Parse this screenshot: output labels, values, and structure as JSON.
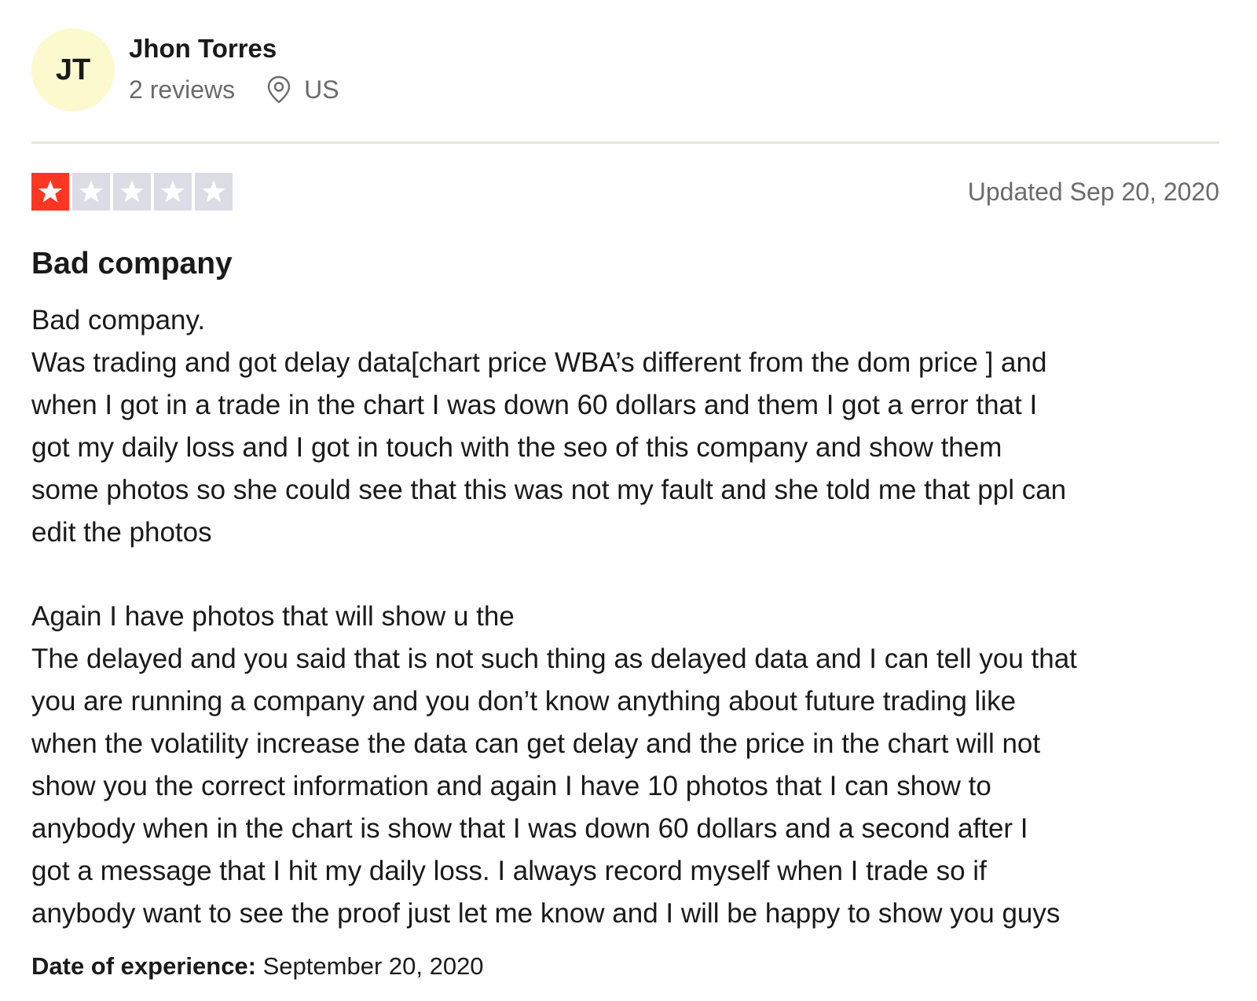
{
  "consumer": {
    "initials": "JT",
    "name": "Jhon Torres",
    "reviews_count": "2 reviews",
    "location": "US",
    "avatar_color": "#fdf9cf"
  },
  "rating": {
    "stars_filled": 1,
    "stars_total": 5,
    "filled_color": "#ff3722",
    "empty_color": "#dcdce6"
  },
  "review": {
    "date_label": "Updated Sep 20, 2020",
    "title": "Bad company",
    "body_lines": [
      "Bad company.",
      "Was trading and got delay data[chart price WBA’s different from the dom price ] and",
      "when I got in a trade in the chart I was down 60 dollars and them I got a error that I",
      "got my daily loss and I got in touch with the seo of this company and show them",
      "some photos so she could see that this was not my fault and she told me that ppl can",
      "edit the photos",
      "",
      "Again I have photos that will show u the",
      "The delayed and you said that is not such thing as delayed data and I can tell you that",
      "you are running a company and you don’t know anything about future trading like",
      "when the volatility increase the data can get delay and the price in the chart will not",
      "show you the correct information and again I have 10 photos that I can show to",
      "anybody when in the chart is show that I was down 60 dollars and a second after I",
      "got a message that I hit my daily loss. I always record myself when I trade so if",
      "anybody want to see the proof just let me know and I will be happy to show you guys"
    ],
    "experience_label": "Date of experience:",
    "experience_value": "September 20, 2020"
  }
}
